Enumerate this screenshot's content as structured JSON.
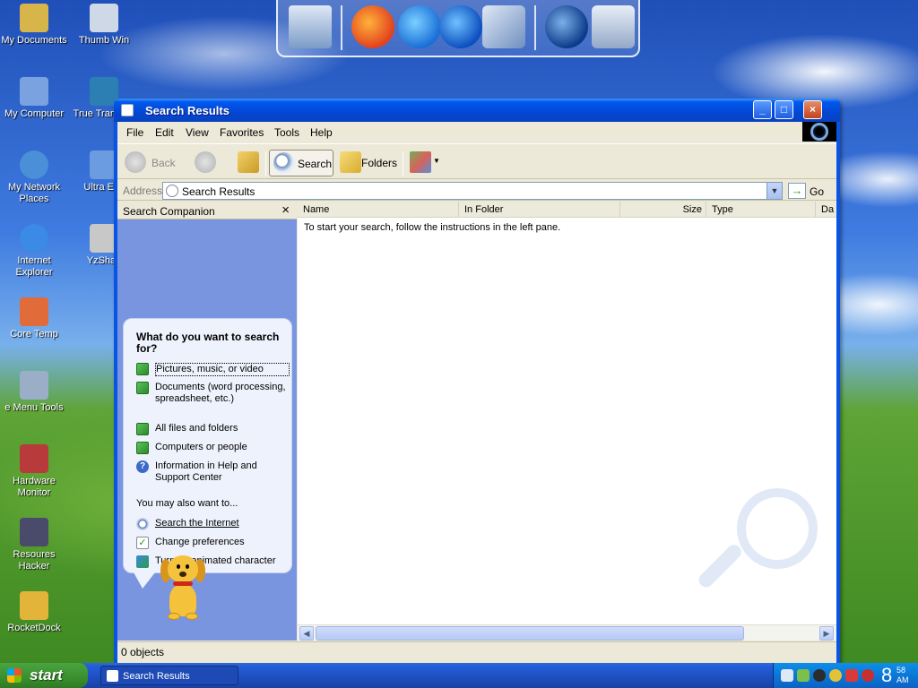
{
  "desktop": {
    "icons": [
      {
        "label": "My Documents",
        "color": "#d8b54a"
      },
      {
        "label": "Thumb Win",
        "color": "#cfd8e6"
      },
      {
        "label": "My Computer",
        "color": "#7aa2e0"
      },
      {
        "label": "True Transpar",
        "color": "#2c7fb2"
      },
      {
        "label": "My Network Places",
        "color": "#4a8fd8"
      },
      {
        "label": "Ultra Exp",
        "color": "#6b9be0"
      },
      {
        "label": "Internet Explorer",
        "color": "#3a8ae6"
      },
      {
        "label": "YzShad",
        "color": "#c8c8c8"
      },
      {
        "label": "Core Temp",
        "color": "#e26b3a"
      },
      {
        "label": "e Menu Tools",
        "color": "#9aaec8"
      },
      {
        "label": "Hardware Monitor",
        "color": "#b83a3a"
      },
      {
        "label": "Resoures Hacker",
        "color": "#4a4a6a"
      },
      {
        "label": "RocketDock",
        "color": "#e2b53a"
      }
    ]
  },
  "dock": {
    "items": [
      "monitor-icon",
      "firefox-icon",
      "internet-explorer-icon",
      "media-player-icon",
      "network-icon",
      "windows-logo-icon",
      "recycle-bin-icon"
    ]
  },
  "window": {
    "title": "Search Results",
    "menu": [
      "File",
      "Edit",
      "View",
      "Favorites",
      "Tools",
      "Help"
    ],
    "toolbar": {
      "back": "Back",
      "search": "Search",
      "folders": "Folders"
    },
    "address": {
      "label": "Address",
      "value": "Search Results",
      "go": "Go"
    },
    "search_companion": {
      "title": "Search Companion",
      "close": "×",
      "question": "What do you want to search for?",
      "options": [
        "Pictures, music, or video",
        "Documents (word processing, spreadsheet, etc.)",
        "All files and folders",
        "Computers or people",
        "Information in Help and Support Center"
      ],
      "also_label": "You may also want to...",
      "also_options": [
        "Search the Internet",
        "Change preferences",
        "Turn off animated character"
      ]
    },
    "results": {
      "columns": [
        "Name",
        "In Folder",
        "Size",
        "Type",
        "Da"
      ],
      "message": "To start your search, follow the instructions in the left pane."
    },
    "status": "0 objects"
  },
  "taskbar": {
    "start": "start",
    "task": "Search Results",
    "clock_hour": "8",
    "clock_min": "58",
    "clock_ampm": "AM"
  },
  "colors": {
    "title_bar": "#0346d3",
    "left_pane": "#7a95e0",
    "start_button": "#3a8f2f"
  }
}
